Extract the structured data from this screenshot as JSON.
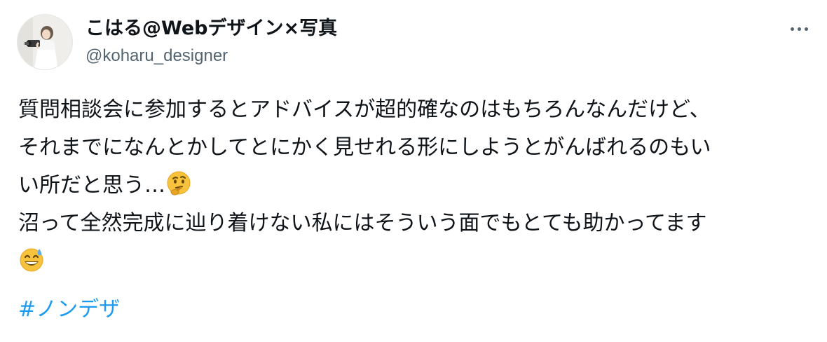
{
  "tweet": {
    "author": {
      "display_name": "こはる@Webデザイン×写真",
      "handle": "@koharu_designer",
      "avatar_icon": "profile-photo"
    },
    "more_icon": "more-options-icon",
    "text": {
      "line1": "質問相談会に参加するとアドバイスが超的確なのはもちろんなんだけど、",
      "line2": "それまでになんとかしてとにかく見せれる形にしようとがんばれるのもい",
      "line3": "い所だと思う…",
      "line3_emoji": "thinking-face-emoji",
      "line4": "沼って全然完成に辿り着けない私にはそういう面でもとても助かってます",
      "line5_emoji": "grinning-face-with-sweat-emoji"
    },
    "hashtag": "#ノンデザ",
    "colors": {
      "name": "#0f1419",
      "handle": "#536471",
      "body": "#0f1419",
      "hashtag": "#1d9bf0"
    }
  }
}
